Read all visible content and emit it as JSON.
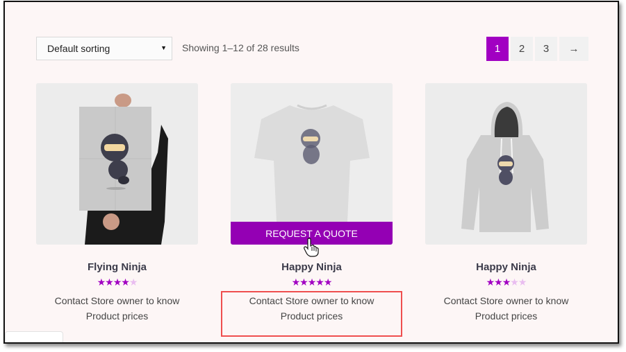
{
  "toolbar": {
    "sort_selected": "Default sorting",
    "result_count": "Showing 1–12 of 28 results"
  },
  "pagination": {
    "pages": [
      "1",
      "2",
      "3"
    ],
    "current": "1",
    "next_label": "→"
  },
  "products": [
    {
      "title": "Flying Ninja",
      "rating": 4,
      "rating_max": 5,
      "price_text": "Contact Store owner to know Product prices",
      "image": "poster-ninja"
    },
    {
      "title": "Happy Ninja",
      "rating": 5,
      "rating_max": 5,
      "price_text": "Contact Store owner to know Product prices",
      "image": "tshirt-ninja",
      "button_label": "REQUEST A QUOTE"
    },
    {
      "title": "Happy Ninja",
      "rating": 3,
      "rating_max": 5,
      "price_text": "Contact Store owner to know Product prices",
      "image": "hoodie-ninja"
    }
  ],
  "colors": {
    "accent": "#a100c2",
    "button": "#9400b4",
    "highlight": "#ef4e4e",
    "star_off": "#e9bdf0"
  }
}
